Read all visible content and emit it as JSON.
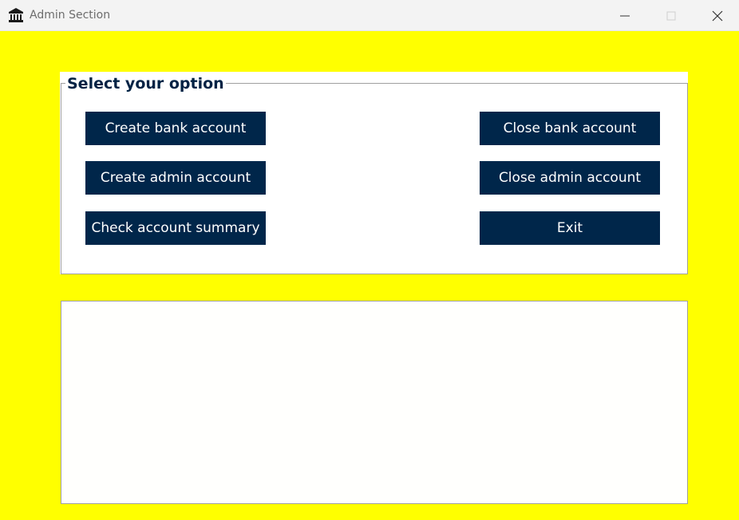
{
  "window": {
    "title": "Admin Section",
    "icon": "bank-building-icon",
    "controls": [
      "minimize-icon",
      "maximize-icon",
      "close-icon"
    ]
  },
  "colors": {
    "background": "#ffff00",
    "button_bg": "#00264a",
    "button_text": "#ffffff",
    "group_title": "#002244"
  },
  "options": {
    "title": "Select your option",
    "create_bank": "Create bank account",
    "create_admin": "Create admin account",
    "check_summary": "Check account summary",
    "close_bank": "Close bank account",
    "close_admin": "Close admin account",
    "exit": "Exit"
  },
  "output": {
    "value": ""
  }
}
